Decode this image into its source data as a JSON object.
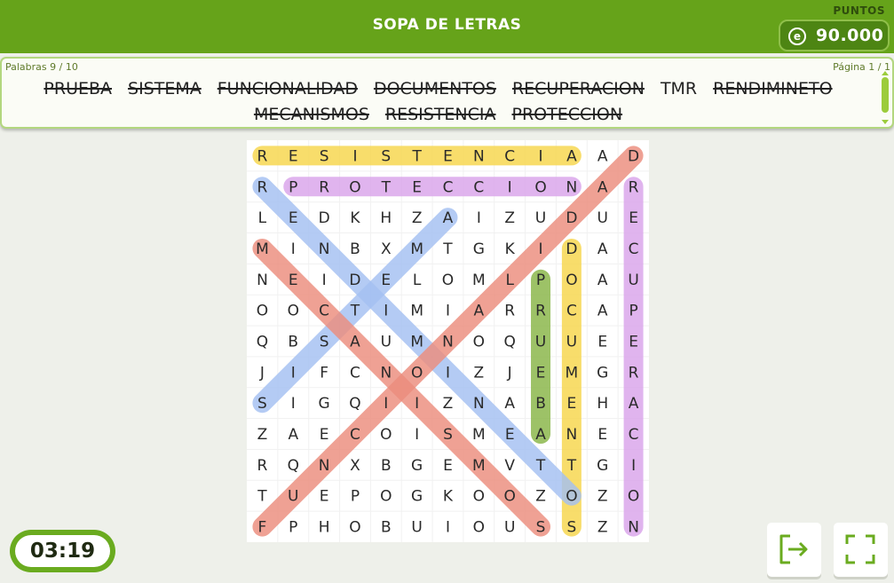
{
  "header": {
    "title": "SOPA DE LETRAS",
    "points_label": "PUNTOS",
    "coin_symbol": "e",
    "points_value": "90.000"
  },
  "words_panel": {
    "count": "Palabras 9 / 10",
    "page": "Página 1 / 1",
    "words": [
      {
        "text": "PRUEBA",
        "found": true
      },
      {
        "text": "SISTEMA",
        "found": true
      },
      {
        "text": "FUNCIONALIDAD",
        "found": true
      },
      {
        "text": "DOCUMENTOS",
        "found": true
      },
      {
        "text": "RECUPERACION",
        "found": true
      },
      {
        "text": "TMR",
        "found": false
      },
      {
        "text": "RENDIMINETO",
        "found": true
      },
      {
        "text": "MECANISMOS",
        "found": true
      },
      {
        "text": "RESISTENCIA",
        "found": true
      },
      {
        "text": "PROTECCION",
        "found": true
      }
    ]
  },
  "grid": {
    "rows": [
      "RESISTENCIAAD",
      "RPROTECCIONAR",
      "LEDKHZAIZUDUE",
      "MINBXMTGKIDAC",
      "NEIDELOMLPOAU",
      "OOCTIMIARRCAP",
      "QBSAUMNOQUUEE",
      "JIFCNOIZJEMGR",
      "SIGQIIZNABEHA",
      "ZAECOISMEANEC",
      "RQNXBGEMVTTGI",
      "TUEPOGKOOZOZO",
      "FPHOBUIOUSSZN"
    ],
    "highlights": [
      {
        "word": "RESISTENCIA",
        "from": [
          0,
          0
        ],
        "to": [
          0,
          10
        ],
        "color": "#f7d54a"
      },
      {
        "word": "PROTECCION",
        "from": [
          1,
          1
        ],
        "to": [
          1,
          10
        ],
        "color": "#d9a3ea"
      },
      {
        "word": "RECUPERACION",
        "from": [
          1,
          12
        ],
        "to": [
          12,
          12
        ],
        "color": "#d9a3ea"
      },
      {
        "word": "DOCUMENTOS",
        "from": [
          3,
          10
        ],
        "to": [
          12,
          10
        ],
        "color": "#f7d54a"
      },
      {
        "word": "PRUEBA",
        "from": [
          4,
          9
        ],
        "to": [
          9,
          9
        ],
        "color": "#87b545"
      },
      {
        "word": "SISTEMA",
        "from": [
          8,
          0
        ],
        "to": [
          2,
          6
        ],
        "color": "#a3c0f2"
      },
      {
        "word": "RENDIMINETO",
        "from": [
          1,
          0
        ],
        "to": [
          11,
          10
        ],
        "color": "#a3c0f2"
      },
      {
        "word": "FUNCIONALIDAD",
        "from": [
          12,
          0
        ],
        "to": [
          0,
          12
        ],
        "color": "#ec8c7c"
      },
      {
        "word": "MECANISMOS",
        "from": [
          3,
          0
        ],
        "to": [
          12,
          9
        ],
        "color": "#ec8c7c"
      }
    ]
  },
  "timer": "03:19",
  "buttons": {
    "exit_icon": "exit-icon",
    "fullscreen_icon": "fullscreen-icon"
  }
}
